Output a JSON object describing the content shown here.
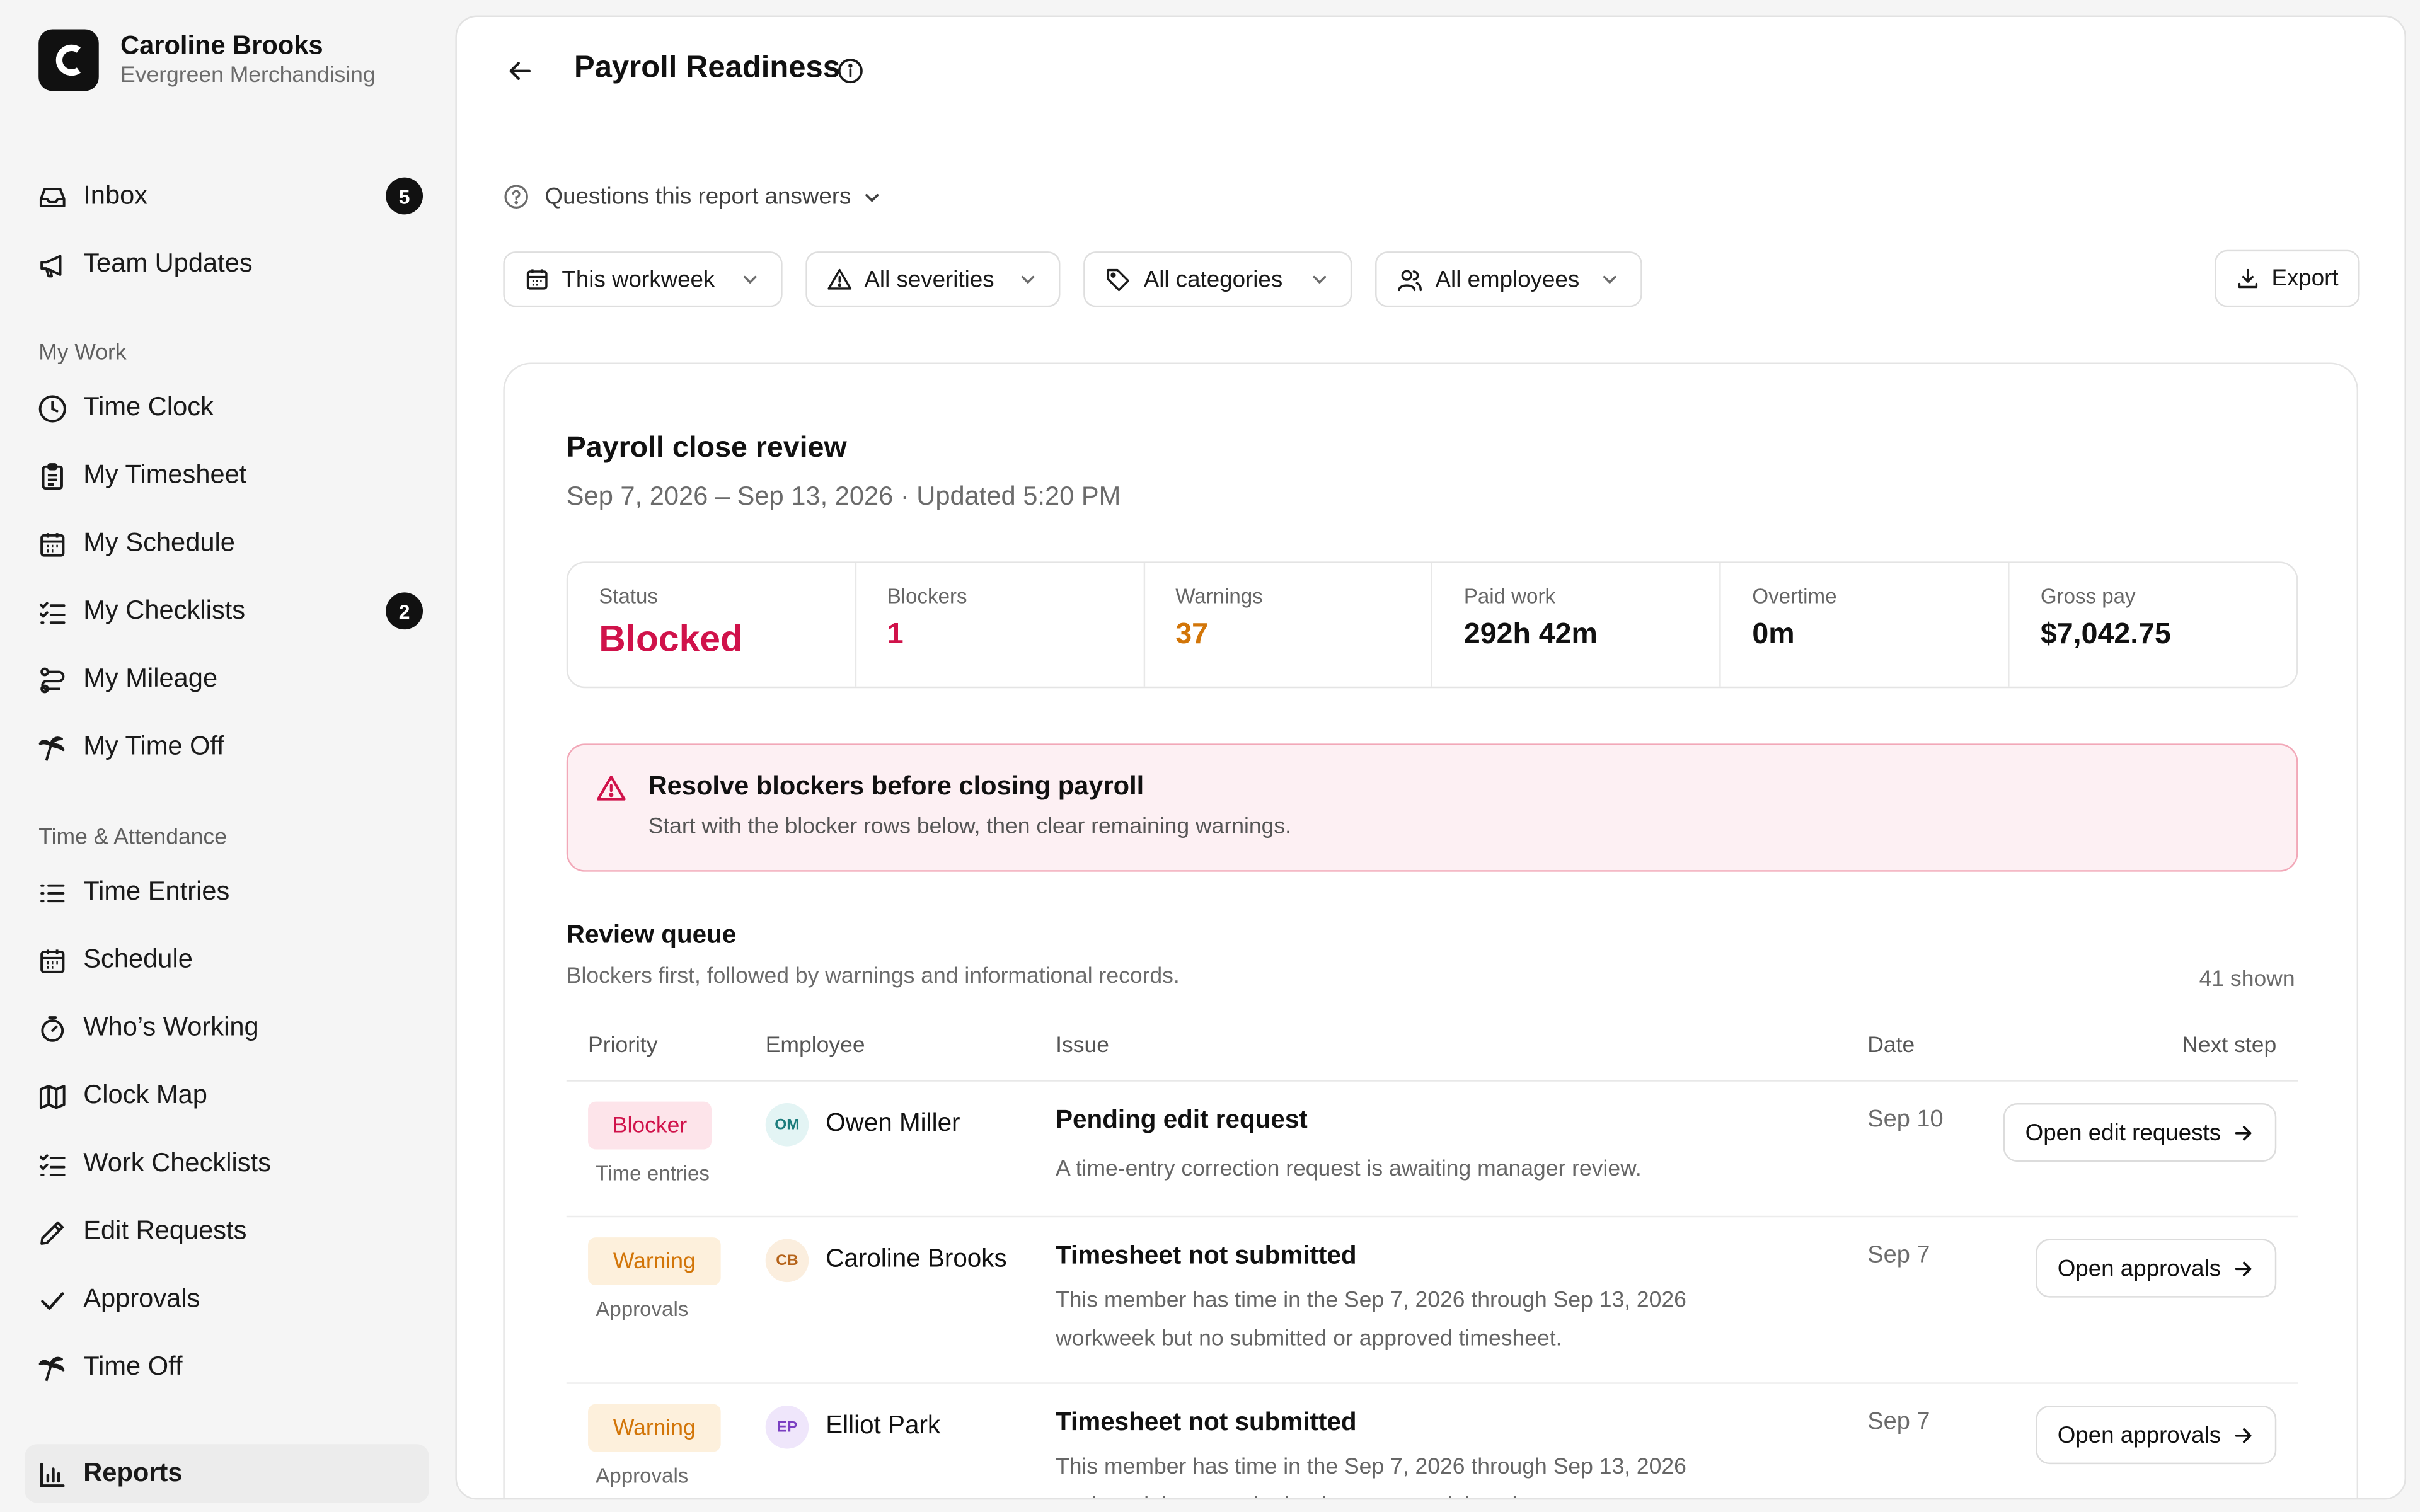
{
  "brand": {
    "name": "Caroline Brooks",
    "org": "Evergreen Merchandising",
    "logo_letter": "C"
  },
  "nav": {
    "top": [
      {
        "label": "Inbox",
        "icon": "inbox-icon",
        "badge": "5"
      },
      {
        "label": "Team Updates",
        "icon": "megaphone-icon"
      }
    ],
    "sections": [
      {
        "label": "My Work",
        "items": [
          {
            "label": "Time Clock",
            "icon": "clock-icon"
          },
          {
            "label": "My Timesheet",
            "icon": "clipboard-icon"
          },
          {
            "label": "My Schedule",
            "icon": "calendar-icon"
          },
          {
            "label": "My Checklists",
            "icon": "checklist-icon",
            "badge": "2"
          },
          {
            "label": "My Mileage",
            "icon": "route-icon"
          },
          {
            "label": "My Time Off",
            "icon": "palm-tree-icon"
          }
        ]
      },
      {
        "label": "Time & Attendance",
        "items": [
          {
            "label": "Time Entries",
            "icon": "list-icon"
          },
          {
            "label": "Schedule",
            "icon": "calendar-icon"
          },
          {
            "label": "Who’s Working",
            "icon": "timer-icon"
          },
          {
            "label": "Clock Map",
            "icon": "map-icon"
          },
          {
            "label": "Work Checklists",
            "icon": "checklist-icon"
          },
          {
            "label": "Edit Requests",
            "icon": "pencil-icon"
          },
          {
            "label": "Approvals",
            "icon": "check-icon"
          },
          {
            "label": "Time Off",
            "icon": "palm-tree-icon"
          }
        ]
      }
    ],
    "active": {
      "label": "Reports",
      "icon": "bar-chart-icon"
    }
  },
  "header": {
    "title": "Payroll Readiness"
  },
  "questions": {
    "label": "Questions this report answers"
  },
  "filters": {
    "period": "This workweek",
    "severity": "All severities",
    "category": "All categories",
    "employees": "All employees",
    "export": "Export"
  },
  "report": {
    "title": "Payroll close review",
    "subtitle": "Sep 7, 2026 – Sep 13, 2026 · Updated 5:20 PM",
    "stats": [
      {
        "label": "Status",
        "value": "Blocked",
        "color": "#d0124a"
      },
      {
        "label": "Blockers",
        "value": "1",
        "color": "#d0124a"
      },
      {
        "label": "Warnings",
        "value": "37",
        "color": "#d27508"
      },
      {
        "label": "Paid work",
        "value": "292h 42m",
        "color": "#111111"
      },
      {
        "label": "Overtime",
        "value": "0m",
        "color": "#111111"
      },
      {
        "label": "Gross pay",
        "value": "$7,042.75",
        "color": "#111111"
      }
    ],
    "alert": {
      "title": "Resolve blockers before closing payroll",
      "body": "Start with the blocker rows below, then clear remaining warnings."
    }
  },
  "queue": {
    "title": "Review queue",
    "subtitle": "Blockers first, followed by warnings and informational records.",
    "count": "41 shown",
    "columns": {
      "priority": "Priority",
      "employee": "Employee",
      "issue": "Issue",
      "date": "Date",
      "next": "Next step"
    },
    "rows": [
      {
        "priority": "Blocker",
        "category": "Time entries",
        "initials": "OM",
        "employee": "Owen Miller",
        "issue": "Pending edit request",
        "description": "A time-entry correction request is awaiting manager review.",
        "date": "Sep 10",
        "action": "Open edit requests"
      },
      {
        "priority": "Warning",
        "category": "Approvals",
        "initials": "CB",
        "employee": "Caroline Brooks",
        "issue": "Timesheet not submitted",
        "description": "This member has time in the Sep 7, 2026 through Sep 13, 2026 workweek but no submitted or approved timesheet.",
        "date": "Sep 7",
        "action": "Open approvals"
      },
      {
        "priority": "Warning",
        "category": "Approvals",
        "initials": "EP",
        "employee": "Elliot Park",
        "issue": "Timesheet not submitted",
        "description": "This member has time in the Sep 7, 2026 through Sep 13, 2026 workweek but no submitted or approved timesheet.",
        "date": "Sep 7",
        "action": "Open approvals"
      }
    ]
  }
}
